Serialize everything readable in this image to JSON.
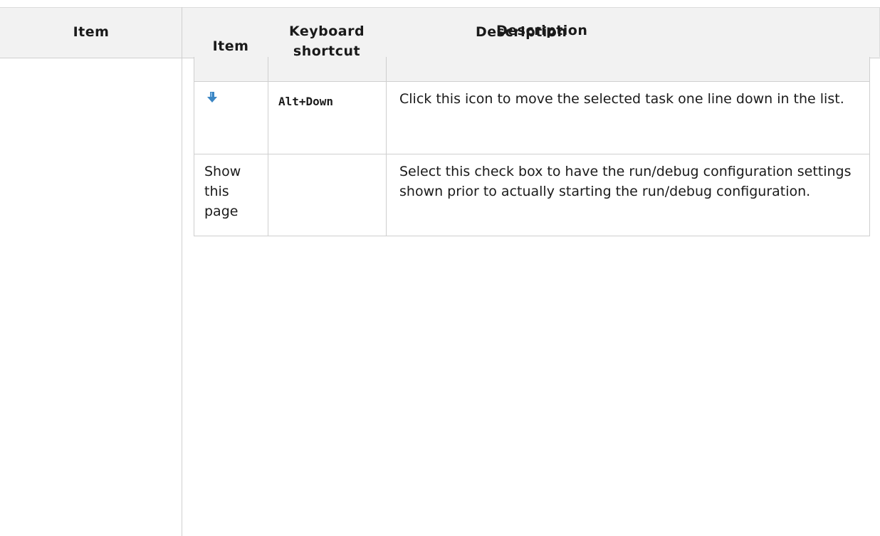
{
  "outer_table": {
    "headers": {
      "item": "Item",
      "description": "Description"
    }
  },
  "inner_table": {
    "headers": {
      "item": "Item",
      "shortcut": "Keyboard shortcut",
      "description": "Description"
    },
    "rows": [
      {
        "item_icon": "arrow-down-icon",
        "item_text": "",
        "shortcut": "Alt+Down",
        "description": "Click this icon to move the selected task one line down in the list."
      },
      {
        "item_icon": "",
        "item_text": "Show this page",
        "shortcut": "",
        "description": "Select this check box to have the run/debug configuration settings shown prior to actually starting the run/debug configuration."
      }
    ]
  },
  "colors": {
    "header_bg": "#f2f2f2",
    "border": "#cfcfcf",
    "icon_blue": "#3b86c4"
  }
}
